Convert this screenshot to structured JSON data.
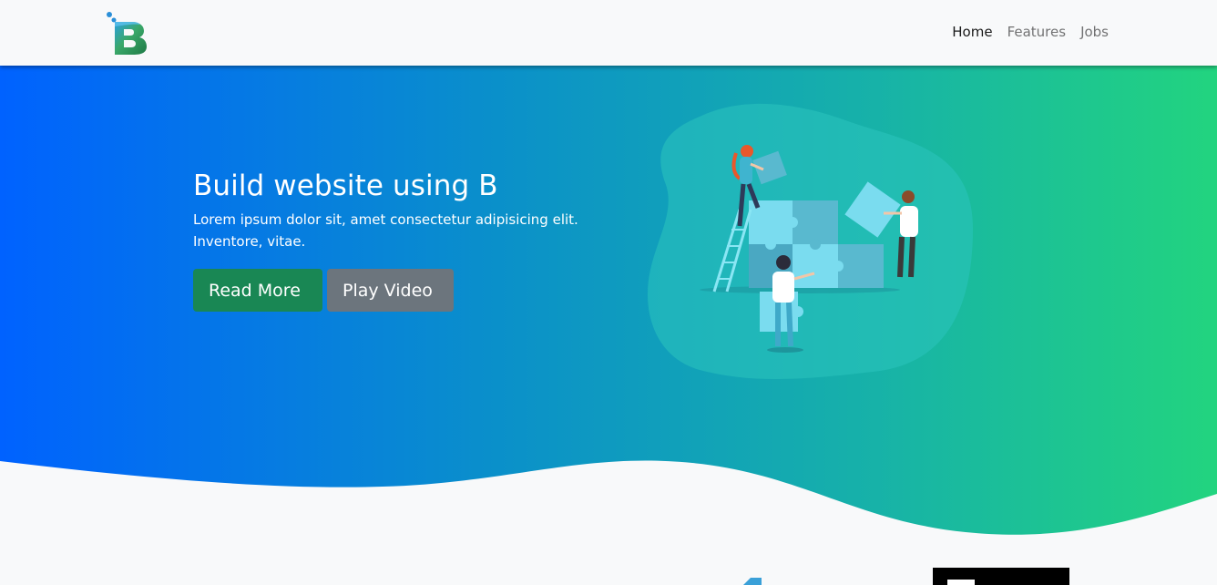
{
  "brand": {
    "logo_letter": "B",
    "colors": {
      "green": "#198754",
      "blue": "#0062ff",
      "teal": "#22d47f",
      "gray": "#6c757d"
    }
  },
  "nav": {
    "items": [
      {
        "label": "Home",
        "active": true
      },
      {
        "label": "Features",
        "active": false
      },
      {
        "label": "Jobs",
        "active": false
      }
    ]
  },
  "hero": {
    "title": "Build website using B",
    "subtitle": "Lorem ipsum dolor sit, amet consectetur adipisicing elit. Inventore, vitae.",
    "buttons": {
      "read_more": "Read More",
      "play_video": "Play Video"
    },
    "illustration_icon": "puzzle-teamwork-illustration"
  }
}
